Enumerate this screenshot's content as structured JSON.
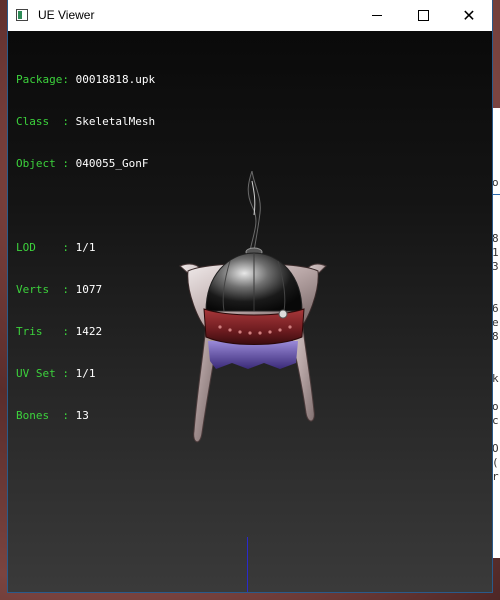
{
  "window": {
    "title": "UE Viewer"
  },
  "info": {
    "package": {
      "label": "Package: ",
      "value": "00018818.upk"
    },
    "class": {
      "label": "Class  : ",
      "value": "SkeletalMesh"
    },
    "object": {
      "label": "Object : ",
      "value": "040055_GonF"
    },
    "lod": {
      "label": "LOD    : ",
      "value": "1/1"
    },
    "verts": {
      "label": "Verts  : ",
      "value": "1077"
    },
    "tris": {
      "label": "Tris   : ",
      "value": "1422"
    },
    "uvset": {
      "label": "UV Set : ",
      "value": "1/1"
    },
    "bones": {
      "label": "Bones  : ",
      "value": "13"
    }
  },
  "background_window": {
    "chars": [
      "o",
      "8",
      "1",
      "3",
      "6",
      "e",
      "8",
      "k",
      "o",
      "c",
      "O",
      "(",
      "r"
    ]
  },
  "colors": {
    "label_green": "#3cd23c",
    "value_white": "#ffffff",
    "axis_blue": "#2a2acc"
  }
}
